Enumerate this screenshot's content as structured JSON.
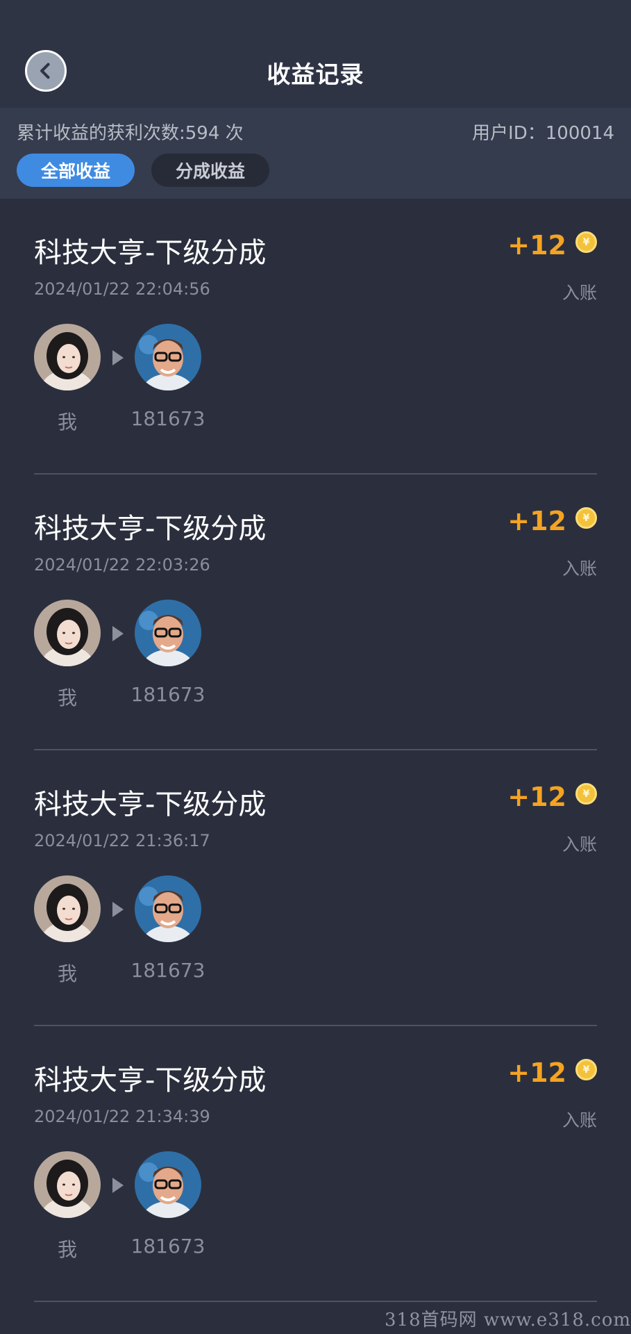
{
  "header": {
    "title": "收益记录",
    "back_icon": "chevron-left-icon"
  },
  "summary": {
    "count_text": "累计收益的获利次数:594 次",
    "user_id_text": "用户ID：100014"
  },
  "tabs": [
    {
      "label": "全部收益",
      "active": true
    },
    {
      "label": "分成收益",
      "active": false
    }
  ],
  "colors": {
    "background": "#2b2f3d",
    "accent": "#3f8be2",
    "amount": "#f5a321"
  },
  "records": [
    {
      "title": "科技大亨-下级分成",
      "time": "2024/01/22 22:04:56",
      "amount": "+12",
      "status": "入账",
      "from_label": "我",
      "to_label": "181673"
    },
    {
      "title": "科技大亨-下级分成",
      "time": "2024/01/22 22:03:26",
      "amount": "+12",
      "status": "入账",
      "from_label": "我",
      "to_label": "181673"
    },
    {
      "title": "科技大亨-下级分成",
      "time": "2024/01/22 21:36:17",
      "amount": "+12",
      "status": "入账",
      "from_label": "我",
      "to_label": "181673"
    },
    {
      "title": "科技大亨-下级分成",
      "time": "2024/01/22 21:34:39",
      "amount": "+12",
      "status": "入账",
      "from_label": "我",
      "to_label": "181673"
    }
  ],
  "coin_symbol": "¥",
  "watermark": "318首码网 www.e318.com"
}
